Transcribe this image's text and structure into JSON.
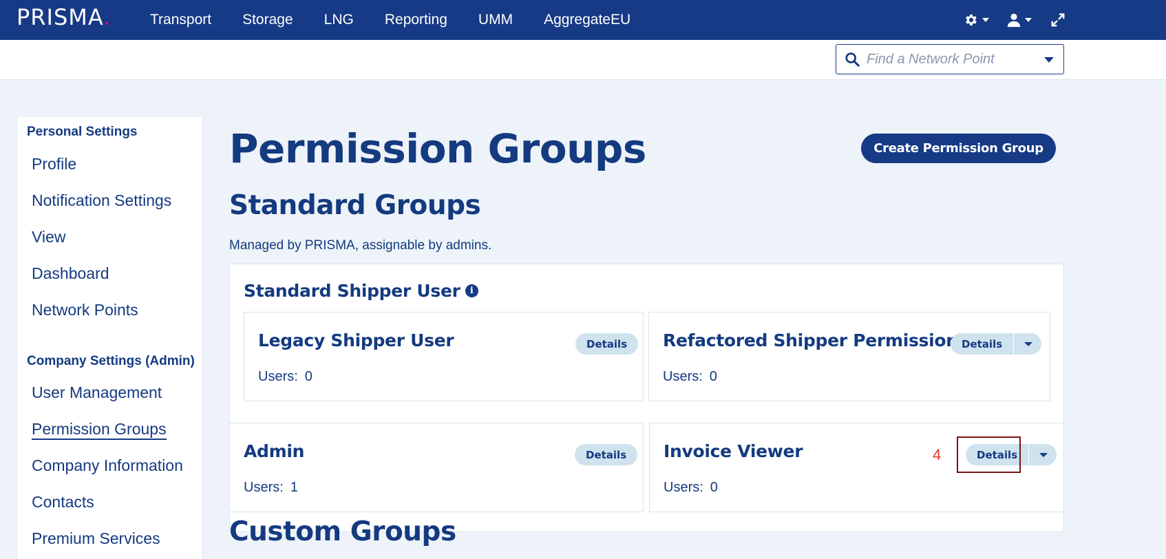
{
  "brand": {
    "logo_text": "PRISMA",
    "logo_dot": ".",
    "accent": "#e5007d"
  },
  "nav": {
    "items": [
      "Transport",
      "Storage",
      "LNG",
      "Reporting",
      "UMM",
      "AggregateEU"
    ],
    "icons": [
      "gear-icon",
      "user-icon",
      "expand-icon"
    ]
  },
  "search": {
    "placeholder": "Find a Network Point"
  },
  "sidebar": {
    "personal_heading": "Personal Settings",
    "personal_items": [
      "Profile",
      "Notification Settings",
      "View",
      "Dashboard",
      "Network Points"
    ],
    "company_heading": "Company Settings (Admin)",
    "company_items": [
      "User Management",
      "Permission Groups",
      "Company Information",
      "Contacts",
      "Premium Services"
    ],
    "active": "Permission Groups"
  },
  "main": {
    "title": "Permission Groups",
    "create_button": "Create Permission Group",
    "standard_title": "Standard Groups",
    "standard_desc": "Managed by PRISMA, assignable by admins.",
    "category_title": "Standard Shipper User",
    "users_label": "Users:",
    "details_label": "Details",
    "cards": [
      {
        "name": "Legacy Shipper User",
        "users": "0"
      },
      {
        "name": "Refactored Shipper Permissions",
        "users": "0"
      },
      {
        "name": "Admin",
        "users": "1"
      },
      {
        "name": "Invoice Viewer",
        "users": "0"
      }
    ],
    "custom_title": "Custom Groups"
  },
  "annotation": {
    "number": "4"
  }
}
